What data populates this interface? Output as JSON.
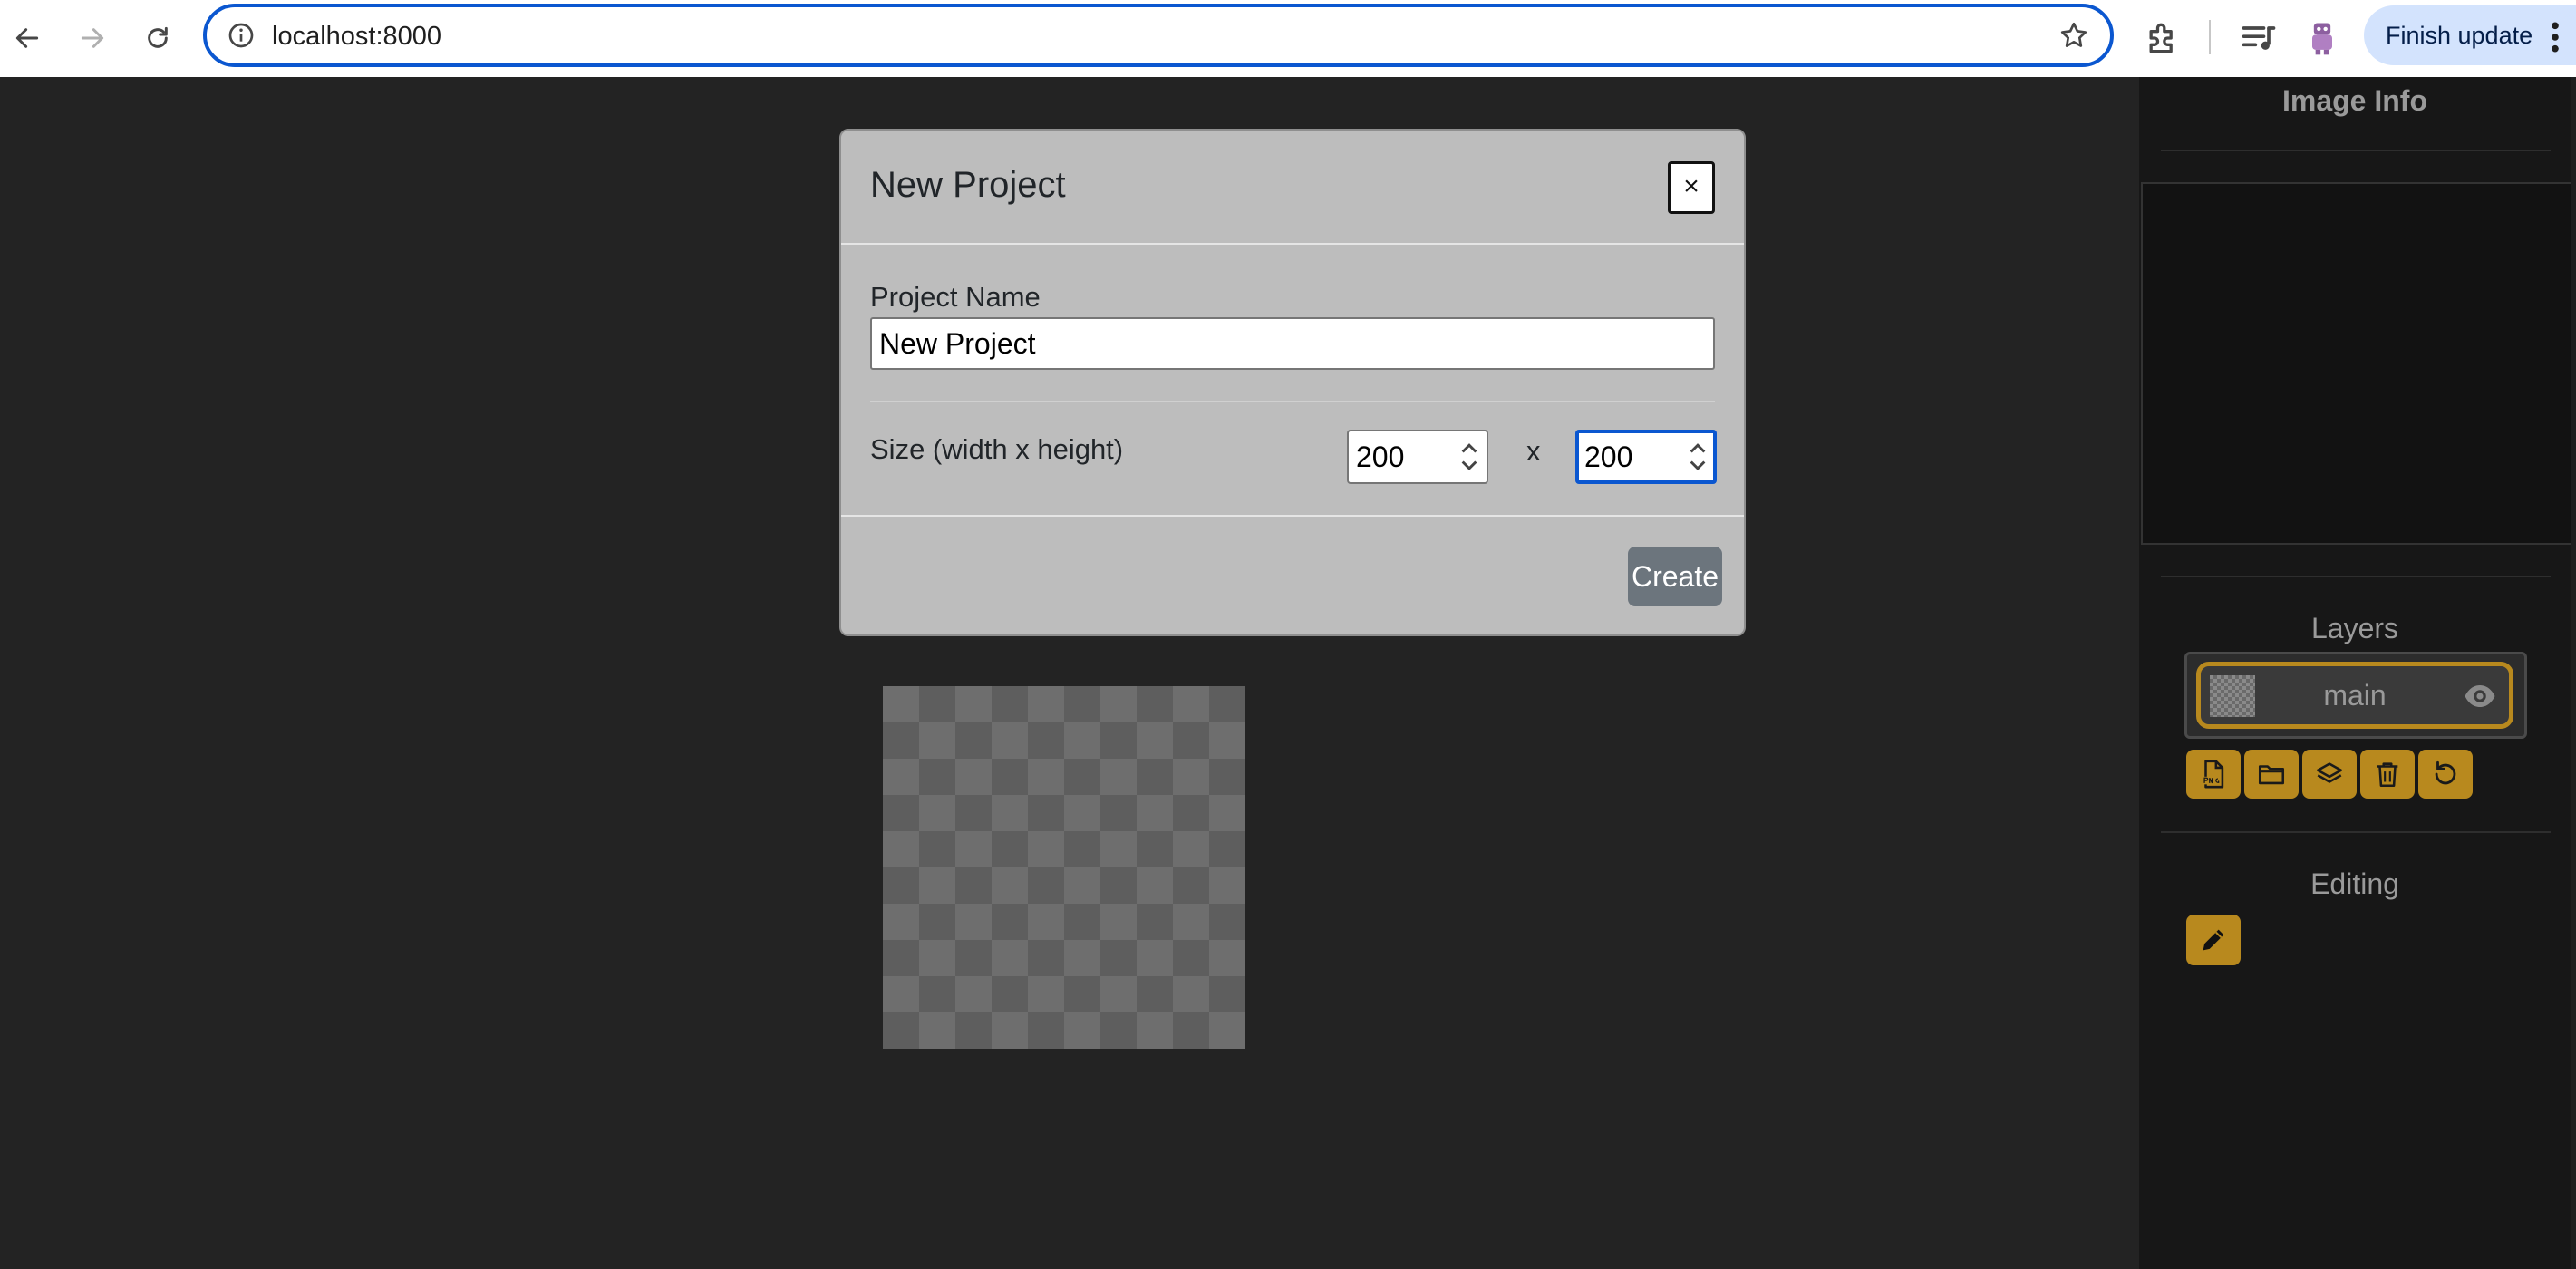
{
  "browser": {
    "url": "localhost:8000",
    "finish_update_label": "Finish update"
  },
  "modal": {
    "title": "New Project",
    "close_label": "×",
    "project_name_label": "Project Name",
    "project_name_value": "New Project",
    "size_label": "Size (width x height)",
    "width_value": "200",
    "height_value": "200",
    "size_separator": "x",
    "create_label": "Create"
  },
  "side_panel": {
    "image_info_title": "Image Info",
    "layers_title": "Layers",
    "layers": [
      {
        "name": "main",
        "visible": true
      }
    ],
    "layer_tools": [
      "png-export-icon",
      "folder-icon",
      "layers-icon",
      "trash-icon",
      "rotate-icon"
    ],
    "editing_title": "Editing",
    "editing_tools": [
      "pencil-icon"
    ]
  },
  "colors": {
    "accent": "#b8891e",
    "page_bg": "#232323",
    "panel_bg": "#171717",
    "modal_bg": "#bdbdbd",
    "focus_ring": "#0b57d0",
    "create_button": "#6c757d"
  }
}
